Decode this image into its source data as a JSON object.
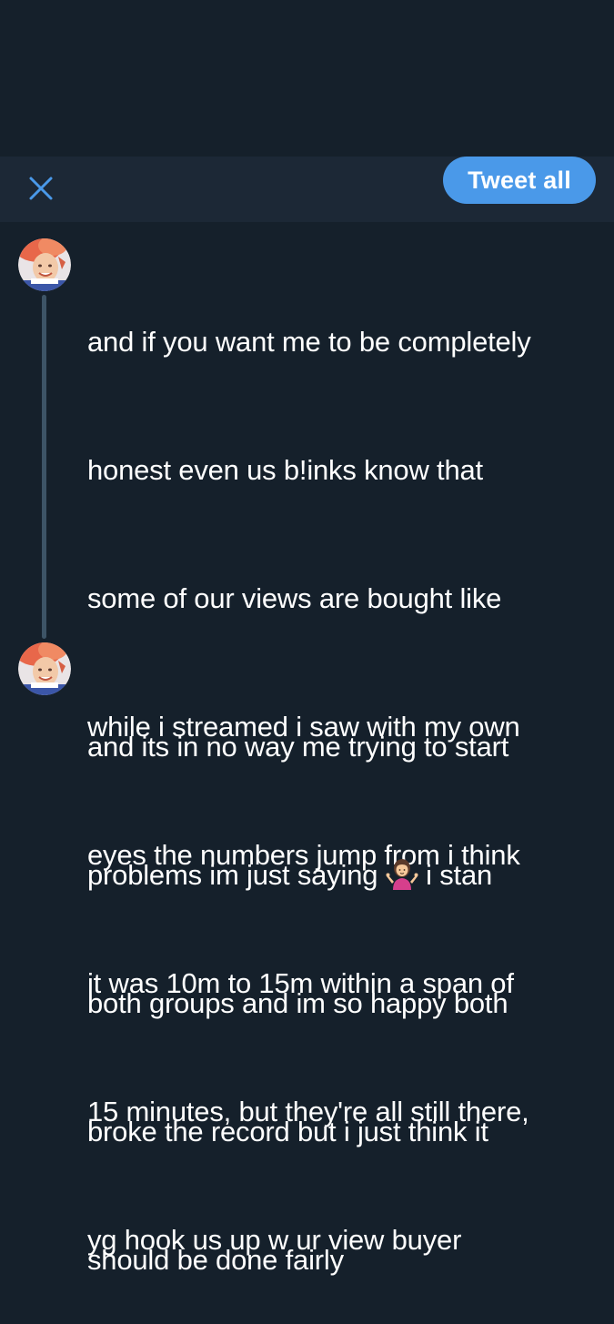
{
  "toolbar": {
    "close_icon": "close-icon",
    "tweet_all_label": "Tweet all",
    "accent_color": "#4a99e9"
  },
  "thread": [
    {
      "avatar_icon": "user-avatar",
      "lines": [
        "and if you want me to be completely",
        "honest even us b!inks know that",
        "some of our views are bought like",
        "while i streamed i saw with my own",
        "eyes the numbers jump from i think",
        "it was 10m to 15m within a span of",
        "15 minutes, but they're all still there,",
        "yg hook us up w ur view buyer"
      ]
    },
    {
      "avatar_icon": "user-avatar",
      "line1": "and its in no way me trying to start",
      "line2_before_emoji": "problems im just saying ",
      "emoji": "person-shrugging-emoji",
      "line2_after_emoji": " i stan",
      "line3": "both groups and im so happy both",
      "line4": "broke the record but i just think it",
      "line5": "should be done fairly"
    }
  ],
  "colors": {
    "background": "#15202b",
    "toolbar": "#1c2836",
    "thread_line": "#3d5466",
    "text": "#ffffff"
  }
}
